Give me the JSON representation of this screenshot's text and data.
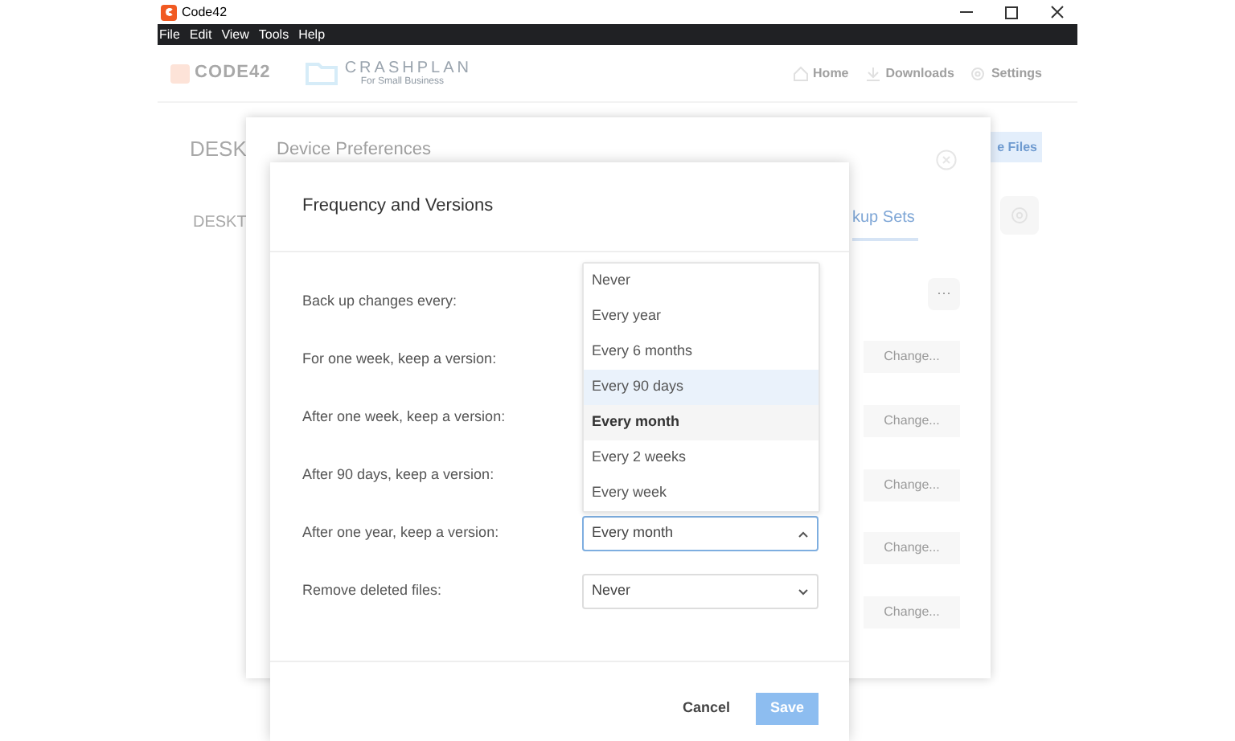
{
  "window": {
    "title": "Code42"
  },
  "menu": [
    "File",
    "Edit",
    "View",
    "Tools",
    "Help"
  ],
  "header": {
    "logo": "CODE42",
    "product": "CRASHPLAN",
    "tagline": "For Small Business",
    "nav": [
      "Home",
      "Downloads",
      "Settings"
    ]
  },
  "page": {
    "heading": "DESK",
    "tab": "DESKT",
    "button": "e Files"
  },
  "device_preferences": {
    "title": "Device Preferences",
    "tab": "kup Sets",
    "more_button": "···",
    "change_buttons": [
      "Change...",
      "Change...",
      "Change...",
      "Change...",
      "Change..."
    ]
  },
  "dialog": {
    "title": "Frequency and Versions",
    "rows": [
      {
        "label": "Back up changes every:"
      },
      {
        "label": "For one week, keep a version:"
      },
      {
        "label": "After one week, keep a version:"
      },
      {
        "label": "After 90 days, keep a version:"
      },
      {
        "label": "After one year, keep a version:",
        "select": {
          "value": "Every month",
          "expanded": true
        }
      },
      {
        "label": "Remove deleted files:",
        "select": {
          "value": "Never",
          "expanded": false
        }
      }
    ],
    "options": [
      {
        "label": "Never",
        "selected": false,
        "hovered": false
      },
      {
        "label": "Every year",
        "selected": false,
        "hovered": false
      },
      {
        "label": "Every 6 months",
        "selected": false,
        "hovered": false
      },
      {
        "label": "Every 90 days",
        "selected": false,
        "hovered": true
      },
      {
        "label": "Every month",
        "selected": true,
        "hovered": false
      },
      {
        "label": "Every 2 weeks",
        "selected": false,
        "hovered": false
      },
      {
        "label": "Every week",
        "selected": false,
        "hovered": false
      }
    ],
    "cancel": "Cancel",
    "save": "Save"
  }
}
